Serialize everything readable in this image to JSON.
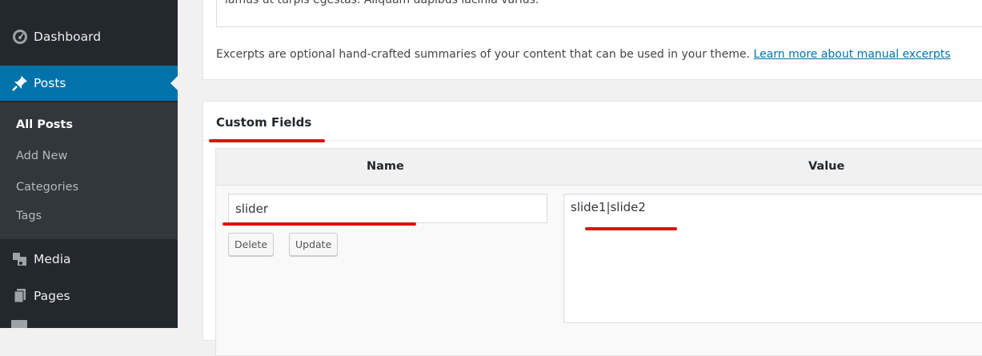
{
  "sidebar": {
    "items": [
      {
        "label": "Dashboard",
        "icon": "dashboard-icon"
      },
      {
        "label": "Posts",
        "icon": "pin-icon"
      },
      {
        "label": "Media",
        "icon": "media-icon"
      },
      {
        "label": "Pages",
        "icon": "pages-icon"
      }
    ],
    "submenu": [
      "All Posts",
      "Add New",
      "Categories",
      "Tags"
    ]
  },
  "excerpt": {
    "text": "lamus ut turpis egestas. Aliquam dapibus lacinia varius.",
    "description": "Excerpts are optional hand-crafted summaries of your content that can be used in your theme.",
    "link": "Learn more about manual excerpts"
  },
  "custom_fields": {
    "title": "Custom Fields",
    "name_header": "Name",
    "value_header": "Value",
    "name_value": "slider",
    "value_value": "slide1|slide2",
    "delete_label": "Delete",
    "update_label": "Update"
  },
  "colors": {
    "sidebar_bg": "#23282d",
    "submenu_bg": "#32373c",
    "accent": "#0073aa",
    "annotation": "#e01010"
  }
}
